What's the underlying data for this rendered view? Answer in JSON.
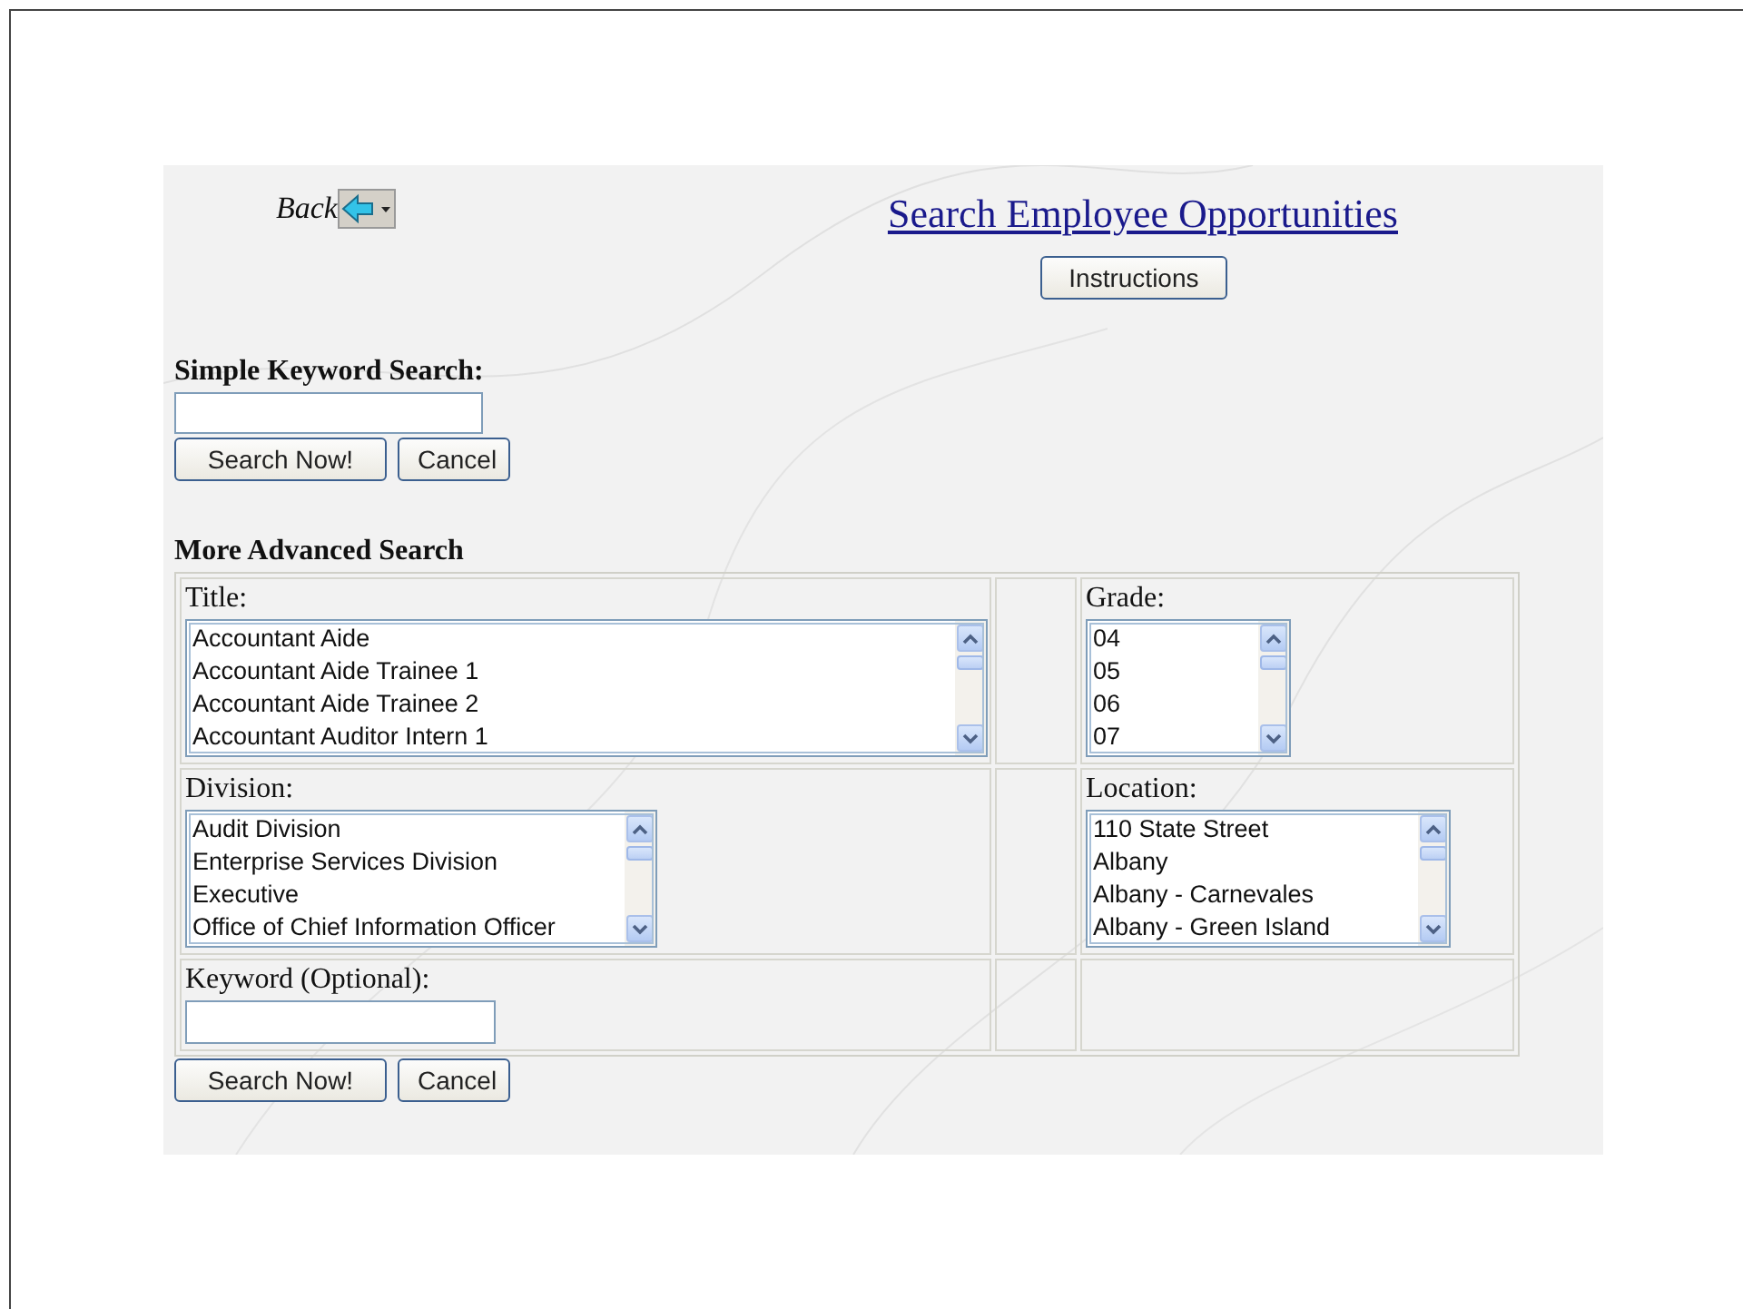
{
  "back_button": {
    "label": "Back"
  },
  "title": "Search Employee Opportunities",
  "instructions_button": "Instructions",
  "simple_search": {
    "label": "Simple Keyword Search:",
    "buttons": [
      "Search Now!",
      "Cancel"
    ]
  },
  "advanced_search": {
    "heading": "More Advanced Search",
    "fields": [
      {
        "kind": "list",
        "label": "Title:",
        "options": [
          "Accountant Aide",
          "Accountant Aide Trainee 1",
          "Accountant Aide Trainee 2",
          "Accountant Auditor Intern 1"
        ]
      },
      {
        "kind": "list",
        "label": "Grade:",
        "options": [
          "04",
          "05",
          "06",
          "07"
        ]
      },
      {
        "kind": "list",
        "label": "Division:",
        "options": [
          "Audit Division",
          "Enterprise Services Division",
          "Executive",
          "Office of Chief Information Officer"
        ]
      },
      {
        "kind": "list",
        "label": "Location:",
        "options": [
          "110 State Street",
          "Albany",
          "Albany - Carnevales",
          "Albany - Green Island"
        ]
      },
      {
        "kind": "text",
        "label": "Keyword (Optional):"
      }
    ],
    "buttons": [
      "Search Now!",
      "Cancel"
    ]
  }
}
